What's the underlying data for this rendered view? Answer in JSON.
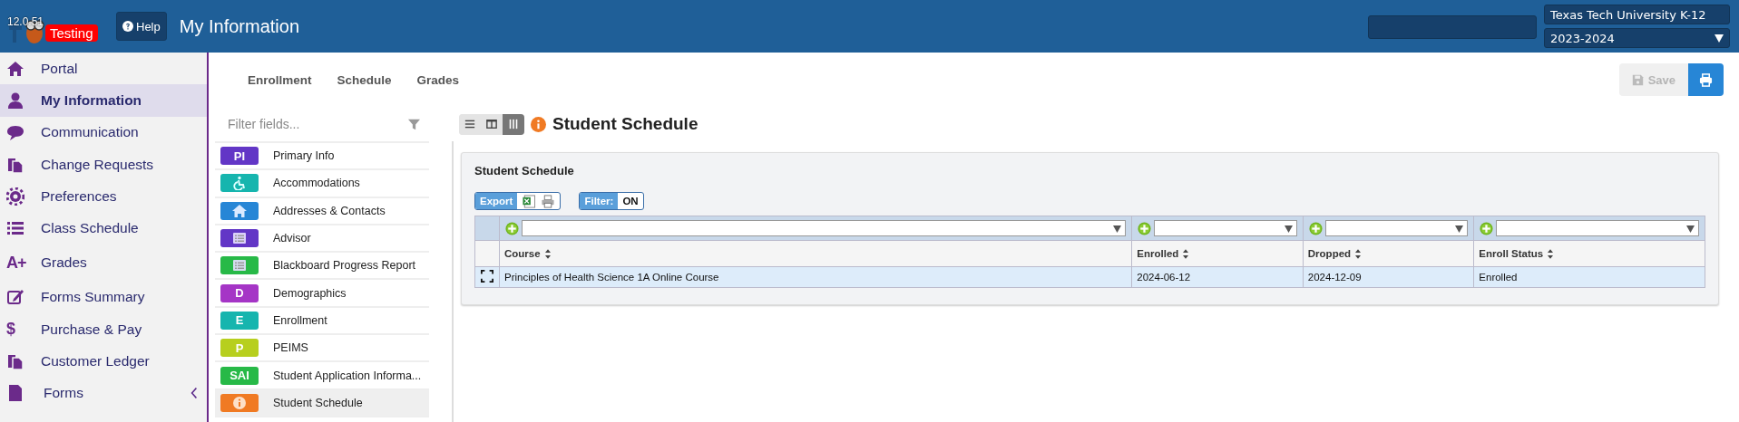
{
  "header": {
    "version": "12.0.51",
    "env_badge": "Testing",
    "help": "Help",
    "title": "My Information",
    "district": "Texas Tech University K-12",
    "year": "2023-2024"
  },
  "sidebar": {
    "items": [
      {
        "label": "Portal",
        "selected": false
      },
      {
        "label": "My Information",
        "selected": true
      },
      {
        "label": "Communication",
        "selected": false
      },
      {
        "label": "Change Requests",
        "selected": false
      },
      {
        "label": "Preferences",
        "selected": false
      },
      {
        "label": "Class Schedule",
        "selected": false
      },
      {
        "label": "Grades",
        "selected": false,
        "kind": "text",
        "icon_text": "A+"
      },
      {
        "label": "Forms Summary",
        "selected": false
      },
      {
        "label": "Purchase & Pay",
        "selected": false,
        "kind": "text",
        "icon_text": "$"
      },
      {
        "label": "Customer Ledger",
        "selected": false
      },
      {
        "label": "Forms",
        "selected": false,
        "expanded": false
      }
    ]
  },
  "sub_tabs": [
    "Enrollment",
    "Schedule",
    "Grades"
  ],
  "toolbar": {
    "save": "Save",
    "save_disabled": true
  },
  "fields": {
    "placeholder": "Filter fields...",
    "items": [
      {
        "label": "Primary Info",
        "kind": "text",
        "badge": "PI",
        "color": "#6236c6",
        "selected": false
      },
      {
        "label": "Accommodations",
        "kind": "icon",
        "color": "#16b5ae",
        "selected": false
      },
      {
        "label": "Addresses & Contacts",
        "kind": "icon",
        "color": "#2786d6",
        "selected": false
      },
      {
        "label": "Advisor",
        "kind": "icon",
        "color": "#6236c6",
        "selected": false
      },
      {
        "label": "Blackboard Progress Report",
        "kind": "icon",
        "color": "#27b947",
        "selected": false
      },
      {
        "label": "Demographics",
        "kind": "text",
        "badge": "D",
        "color": "#a535c6",
        "selected": false
      },
      {
        "label": "Enrollment",
        "kind": "text",
        "badge": "E",
        "color": "#16b5ae",
        "selected": false
      },
      {
        "label": "PEIMS",
        "kind": "text",
        "badge": "P",
        "color": "#b7cf1e",
        "selected": false
      },
      {
        "label": "Student Application Informa...",
        "kind": "text",
        "badge": "SAI",
        "color": "#27b947",
        "selected": false
      },
      {
        "label": "Student Schedule",
        "kind": "icon",
        "color": "#f07a23",
        "selected": true
      }
    ]
  },
  "view_modes": [
    {
      "selected": false
    },
    {
      "selected": false
    },
    {
      "selected": true
    }
  ],
  "page_title": "Student Schedule",
  "card": {
    "title": "Student Schedule",
    "export": "Export",
    "filter_label": "Filter:",
    "filter_state": "ON",
    "columns": [
      "Course",
      "Enrolled",
      "Dropped",
      "Enroll Status"
    ],
    "rows": [
      {
        "selected": true,
        "cells": [
          "Principles of Health Science 1A Online Course",
          "2024-06-12",
          "2024-12-09",
          "Enrolled"
        ]
      }
    ]
  }
}
